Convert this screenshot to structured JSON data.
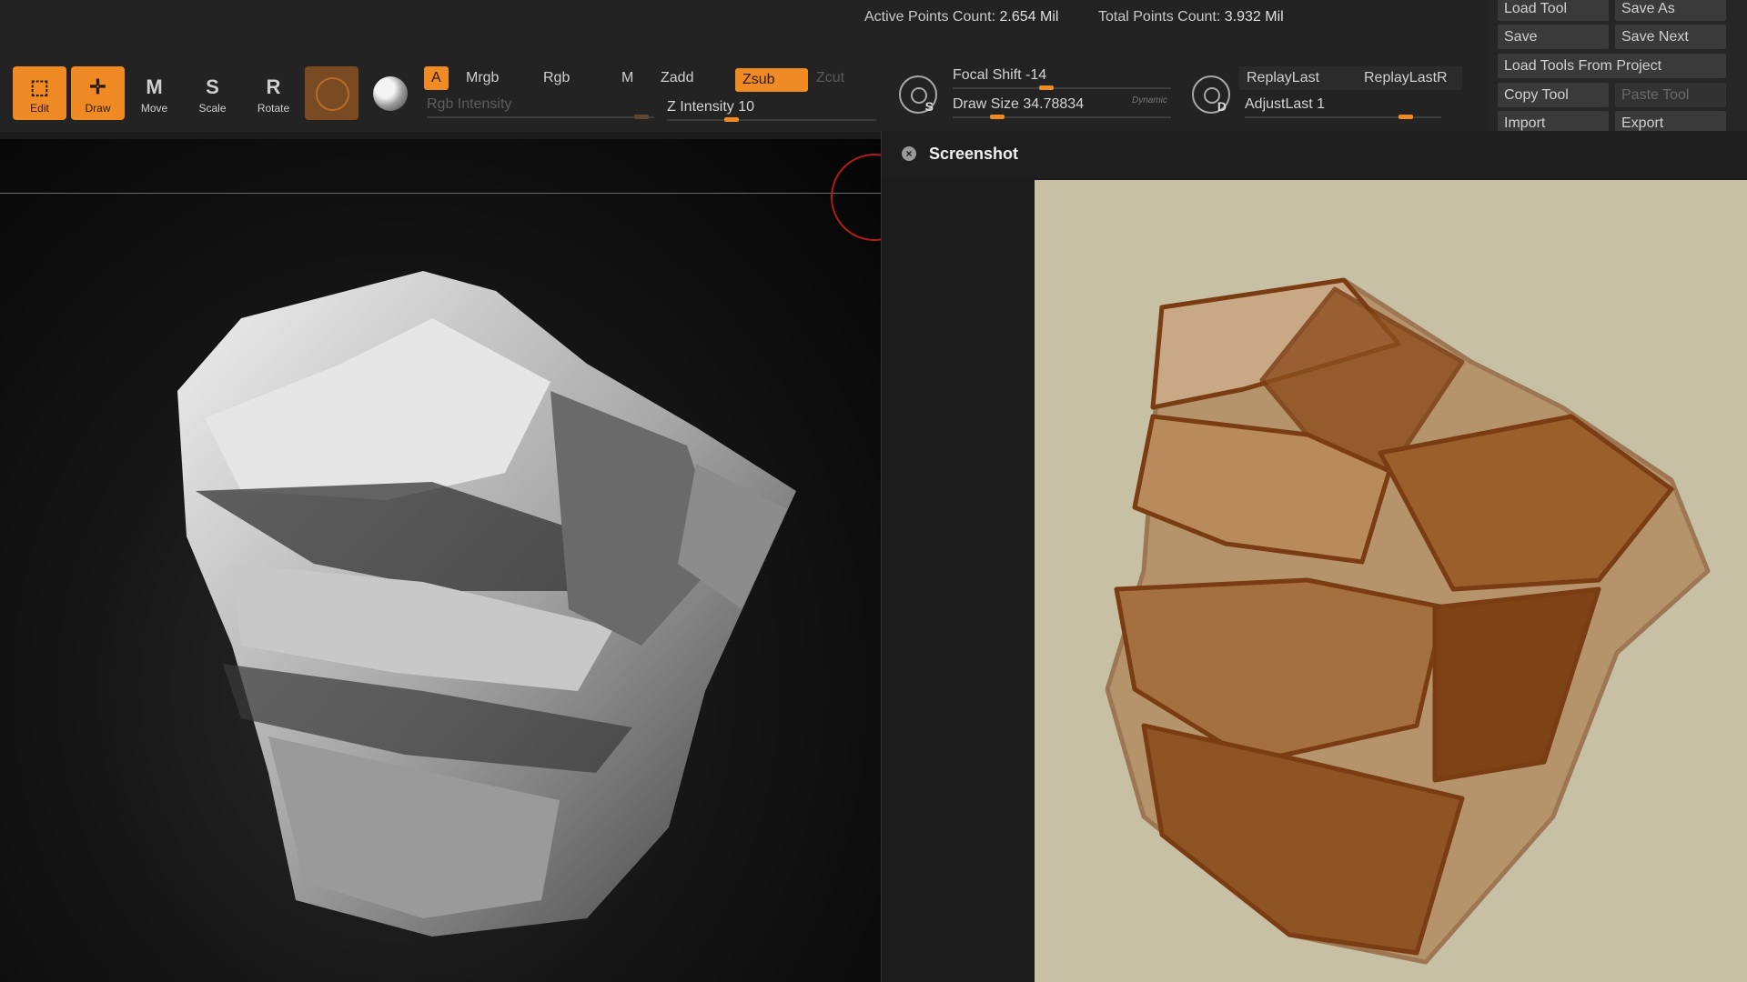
{
  "status": {
    "active_label": "Active Points Count:",
    "active_value": "2.654 Mil",
    "total_label": "Total Points Count:",
    "total_value": "3.932 Mil"
  },
  "tools": [
    {
      "label": "Edit",
      "icon": "edit-icon",
      "active": true
    },
    {
      "label": "Draw",
      "icon": "draw-icon",
      "active": true
    },
    {
      "label": "Move",
      "icon": "move-icon",
      "active": false
    },
    {
      "label": "Scale",
      "icon": "scale-icon",
      "active": false
    },
    {
      "label": "Rotate",
      "icon": "rotate-icon",
      "active": false
    }
  ],
  "modes": {
    "a": "A",
    "mrgb": "Mrgb",
    "rgb": "Rgb",
    "m": "M",
    "zadd": "Zadd",
    "zsub": "Zsub",
    "zcut": "Zcut",
    "rgb_intensity": "Rgb Intensity",
    "z_intensity": "Z Intensity 10"
  },
  "brush": {
    "focal_shift": "Focal Shift -14",
    "draw_size": "Draw Size 34.78834",
    "dynamic": "Dynamic",
    "s_letter": "S",
    "d_letter": "D"
  },
  "replay": {
    "replay_last": "ReplayLast",
    "replay_last_rel": "ReplayLastR",
    "adjust_last": "AdjustLast 1"
  },
  "tool_panel": {
    "load_tool": "Load Tool",
    "save_as": "Save As",
    "save": "Save",
    "save_next": "Save Next",
    "load_from_project": "Load Tools From Project",
    "copy_tool": "Copy Tool",
    "paste_tool": "Paste Tool",
    "import": "Import",
    "export": "Export"
  },
  "screenshot_panel": {
    "title": "Screenshot"
  },
  "colors": {
    "accent": "#f08a24",
    "panel": "#232323",
    "sketch_bg": "#c8c0a4",
    "sketch_ink": "#7a3c12"
  }
}
